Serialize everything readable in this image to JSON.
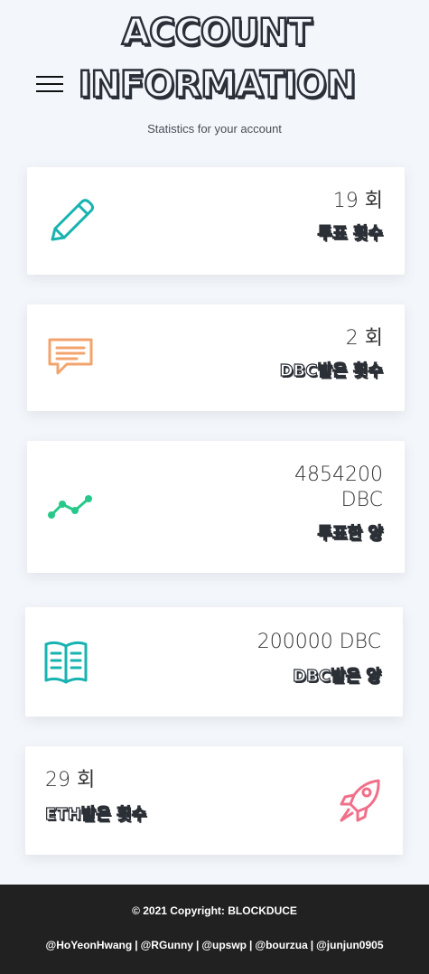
{
  "header": {
    "title_line1": "ACCOUNT",
    "title_line2": "INFORMATION",
    "subtitle": "Statistics for your account"
  },
  "cards": [
    {
      "icon": "pencil-icon",
      "value": "19 회",
      "label": "투표 횟수",
      "color": "#17b3b0"
    },
    {
      "icon": "message-icon",
      "value": "2 회",
      "label": "DBC받은 횟수",
      "color": "#f3a46e"
    },
    {
      "icon": "trend-icon",
      "value_line1": "4854200",
      "value_line2": "DBC",
      "label": "투표한 양",
      "color": "#26c98a"
    },
    {
      "icon": "book-icon",
      "value": "200000 DBC",
      "label": "DBC받은 양",
      "color": "#17b3b0"
    },
    {
      "icon": "rocket-icon",
      "value": "29 회",
      "label": "ETH받은 횟수",
      "color": "#f0708a"
    }
  ],
  "footer": {
    "copyright": "© 2021 Copyright: BLOCKDUCE",
    "credits": [
      "@HoYeonHwang",
      "@RGunny",
      "@upswp",
      "@bourzua",
      "@junjun0905"
    ],
    "separator": "|"
  }
}
